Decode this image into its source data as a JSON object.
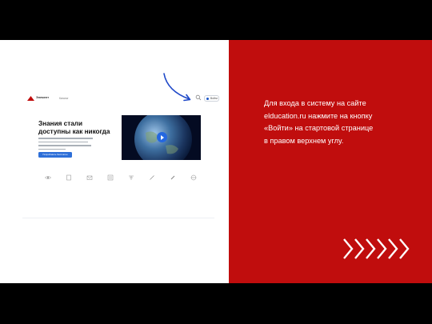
{
  "slide": {
    "caption_lines": [
      "Для входа в систему на сайте",
      "elducation.ru нажмите на кнопку",
      "«Войти» на стартовой странице",
      "в правом верхнем углу."
    ],
    "colors": {
      "accent_red": "#c00d0d",
      "brand_blue": "#2e6fd8"
    }
  },
  "site": {
    "logo_text": "Элемент",
    "nav_link": "Каталог",
    "login_label": "Войти",
    "hero_title_line1": "Знания стали",
    "hero_title_line2": "доступны как никогда",
    "cta_label": "Попробовать бесплатно",
    "icons": [
      "search-icon",
      "play-icon",
      "arrow-pointer-icon",
      "chevron-right-icon"
    ],
    "category_icons": [
      "atom-icon",
      "book-icon",
      "envelope-icon",
      "list-icon",
      "math-icon",
      "pen-icon",
      "test-tube-icon",
      "globe-icon"
    ]
  }
}
